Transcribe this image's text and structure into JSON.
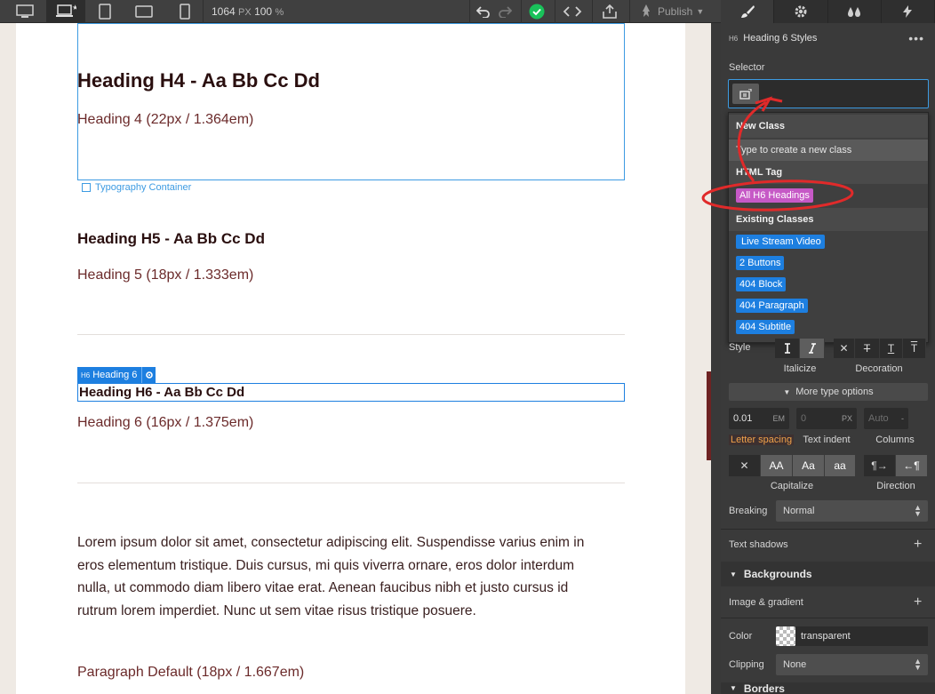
{
  "toolbar": {
    "width_value": "1064",
    "width_unit": "PX",
    "zoom_value": "100",
    "zoom_unit": "%",
    "publish_label": "Publish"
  },
  "canvas": {
    "h4_title": "Heading H4 - Aa Bb Cc Dd",
    "h4_meta": "Heading 4 (22px / 1.364em)",
    "container_label": "Typography Container",
    "h5_title": "Heading H5 - Aa Bb Cc Dd",
    "h5_meta": "Heading 5 (18px / 1.333em)",
    "h6_tag_prefix": "H6",
    "h6_tag_name": "Heading 6",
    "h6_title": "Heading H6 - Aa Bb Cc Dd",
    "h6_meta": "Heading 6 (16px / 1.375em)",
    "lorem": "Lorem ipsum dolor sit amet, consectetur adipiscing elit. Suspendisse varius enim in eros elementum tristique. Duis cursus, mi quis viverra ornare, eros dolor interdum nulla, ut commodo diam libero vitae erat. Aenean faucibus nibh et justo cursus id rutrum lorem imperdiet. Nunc ut sem vitae risus tristique posuere.",
    "para_meta": "Paragraph Default (18px / 1.667em)"
  },
  "panel": {
    "header_tag": "H6",
    "header_title": "Heading 6 Styles",
    "selector_label": "Selector",
    "dropdown": {
      "new_class_header": "New Class",
      "create_hint": "Type to create a new class",
      "html_tag_header": "HTML Tag",
      "html_tag_item": "All H6 Headings",
      "existing_header": "Existing Classes",
      "classes": [
        "Live Stream Video",
        "2 Buttons",
        "404 Block",
        "404 Paragraph",
        "404 Subtitle"
      ]
    },
    "style_label": "Style",
    "italicize_label": "Italicize",
    "decoration_label": "Decoration",
    "more_type_options": "More type options",
    "letter_spacing_value": "0.01",
    "letter_spacing_unit": "EM",
    "text_indent_value": "0",
    "text_indent_unit": "PX",
    "columns_value": "Auto",
    "columns_unit": "-",
    "letter_spacing_label": "Letter spacing",
    "text_indent_label": "Text indent",
    "columns_label": "Columns",
    "cap_upper": "AA",
    "cap_title": "Aa",
    "cap_lower": "aa",
    "capitalize_label": "Capitalize",
    "direction_label": "Direction",
    "breaking_label": "Breaking",
    "breaking_value": "Normal",
    "text_shadows_label": "Text shadows",
    "backgrounds_label": "Backgrounds",
    "image_gradient_label": "Image & gradient",
    "color_label": "Color",
    "color_value": "transparent",
    "clipping_label": "Clipping",
    "clipping_value": "None",
    "borders_label": "Borders"
  },
  "colors": {
    "accent_blue": "#3d9be2",
    "tag_magenta": "#c659c6",
    "annotation_red": "#e02a2a"
  }
}
